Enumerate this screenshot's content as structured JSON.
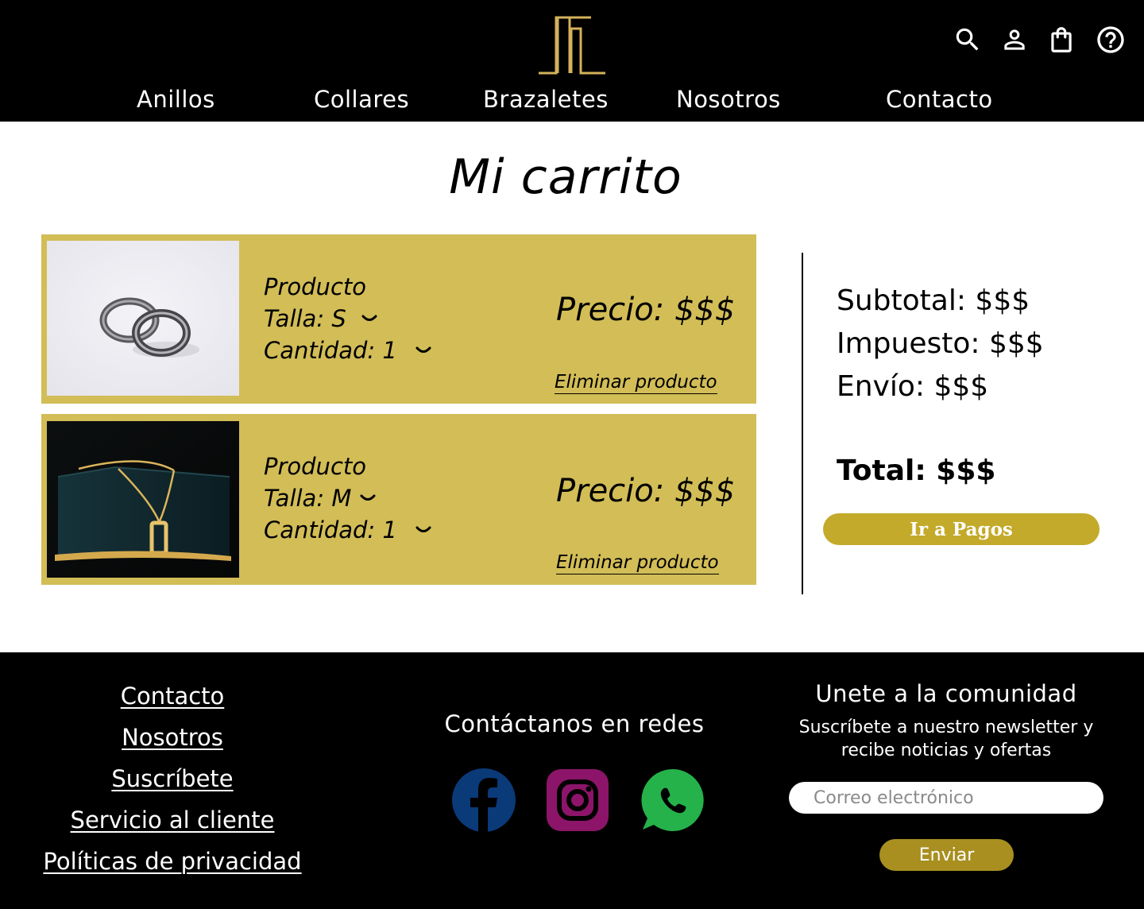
{
  "header": {
    "nav": [
      "Anillos",
      "Collares",
      "Brazaletes",
      "Nosotros",
      "Contacto"
    ],
    "icons": [
      "search-icon",
      "user-icon",
      "shopping-bag-icon",
      "help-icon"
    ]
  },
  "colors": {
    "header_bg": "#000000",
    "logo_gold": "#d4b25a",
    "card_bg": "#d2bd57",
    "pay_button": "#c3aa2a",
    "send_button": "#a88f20",
    "facebook": "#0a3a78",
    "instagram": "#8c1569",
    "whatsapp": "#25b24a"
  },
  "page": {
    "title": "Mi carrito"
  },
  "cart": {
    "items": [
      {
        "name": "Producto",
        "size": "Talla: S",
        "qty": "Cantidad: 1",
        "price": "Precio: $$$",
        "remove": "Eliminar producto"
      },
      {
        "name": "Producto",
        "size": "Talla: M",
        "qty": "Cantidad: 1",
        "price": "Precio: $$$",
        "remove": "Eliminar producto"
      }
    ]
  },
  "summary": {
    "subtotal": "Subtotal: $$$",
    "tax": "Impuesto: $$$",
    "shipping": "Envío: $$$",
    "total": "Total: $$$",
    "pay_button": "Ir a Pagos"
  },
  "footer": {
    "links": [
      "Contacto",
      "Nosotros",
      "Suscríbete",
      "Servicio al cliente",
      "Políticas de privacidad"
    ],
    "social_title": "Contáctanos en redes",
    "community_title": "Unete a la comunidad",
    "community_sub": "Suscríbete a nuestro newsletter y recibe noticias y ofertas",
    "email_placeholder": "Correo electrónico",
    "send_button": "Enviar"
  }
}
